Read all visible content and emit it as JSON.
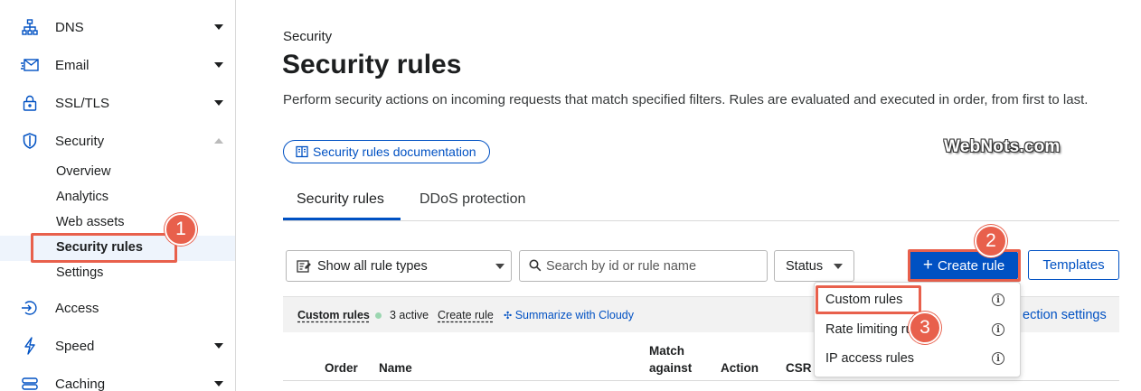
{
  "sidebar": {
    "items": [
      {
        "label": "DNS",
        "icon": "network-icon"
      },
      {
        "label": "Email",
        "icon": "email-icon"
      },
      {
        "label": "SSL/TLS",
        "icon": "lock-icon"
      },
      {
        "label": "Security",
        "icon": "shield-icon"
      },
      {
        "label": "Access",
        "icon": "access-icon"
      },
      {
        "label": "Speed",
        "icon": "lightning-icon"
      },
      {
        "label": "Caching",
        "icon": "database-icon"
      }
    ],
    "security_sub": [
      "Overview",
      "Analytics",
      "Web assets",
      "Security rules",
      "Settings"
    ]
  },
  "annotations": {
    "badge1": "1",
    "badge2": "2",
    "badge3": "3",
    "accent": "#e8604c"
  },
  "main": {
    "breadcrumb": "Security",
    "title": "Security rules",
    "description": "Perform security actions on incoming requests that match specified filters. Rules are evaluated and executed in order, from first to last.",
    "doc_button": "Security rules documentation",
    "watermark": "WebNots.com",
    "tabs": [
      "Security rules",
      "DDoS protection"
    ]
  },
  "toolbar": {
    "rule_type_select": "Show all rule types",
    "search_placeholder": "Search by id or rule name",
    "status_select": "Status",
    "create_button": "Create rule",
    "templates_button": "Templates"
  },
  "infobar": {
    "custom_rules": "Custom rules",
    "active": "3 active",
    "create_rule": "Create rule",
    "summarize": "Summarize with Cloudy",
    "protection_settings": "ection settings"
  },
  "table": {
    "headers": [
      "Order",
      "Name",
      "Match against",
      "Action",
      "CSR"
    ]
  },
  "dropdown": {
    "items": [
      "Custom rules",
      "Rate limiting ru",
      "IP access rules"
    ],
    "info": "i"
  },
  "colors": {
    "primary": "#0051c3",
    "text": "#1d1f20"
  }
}
